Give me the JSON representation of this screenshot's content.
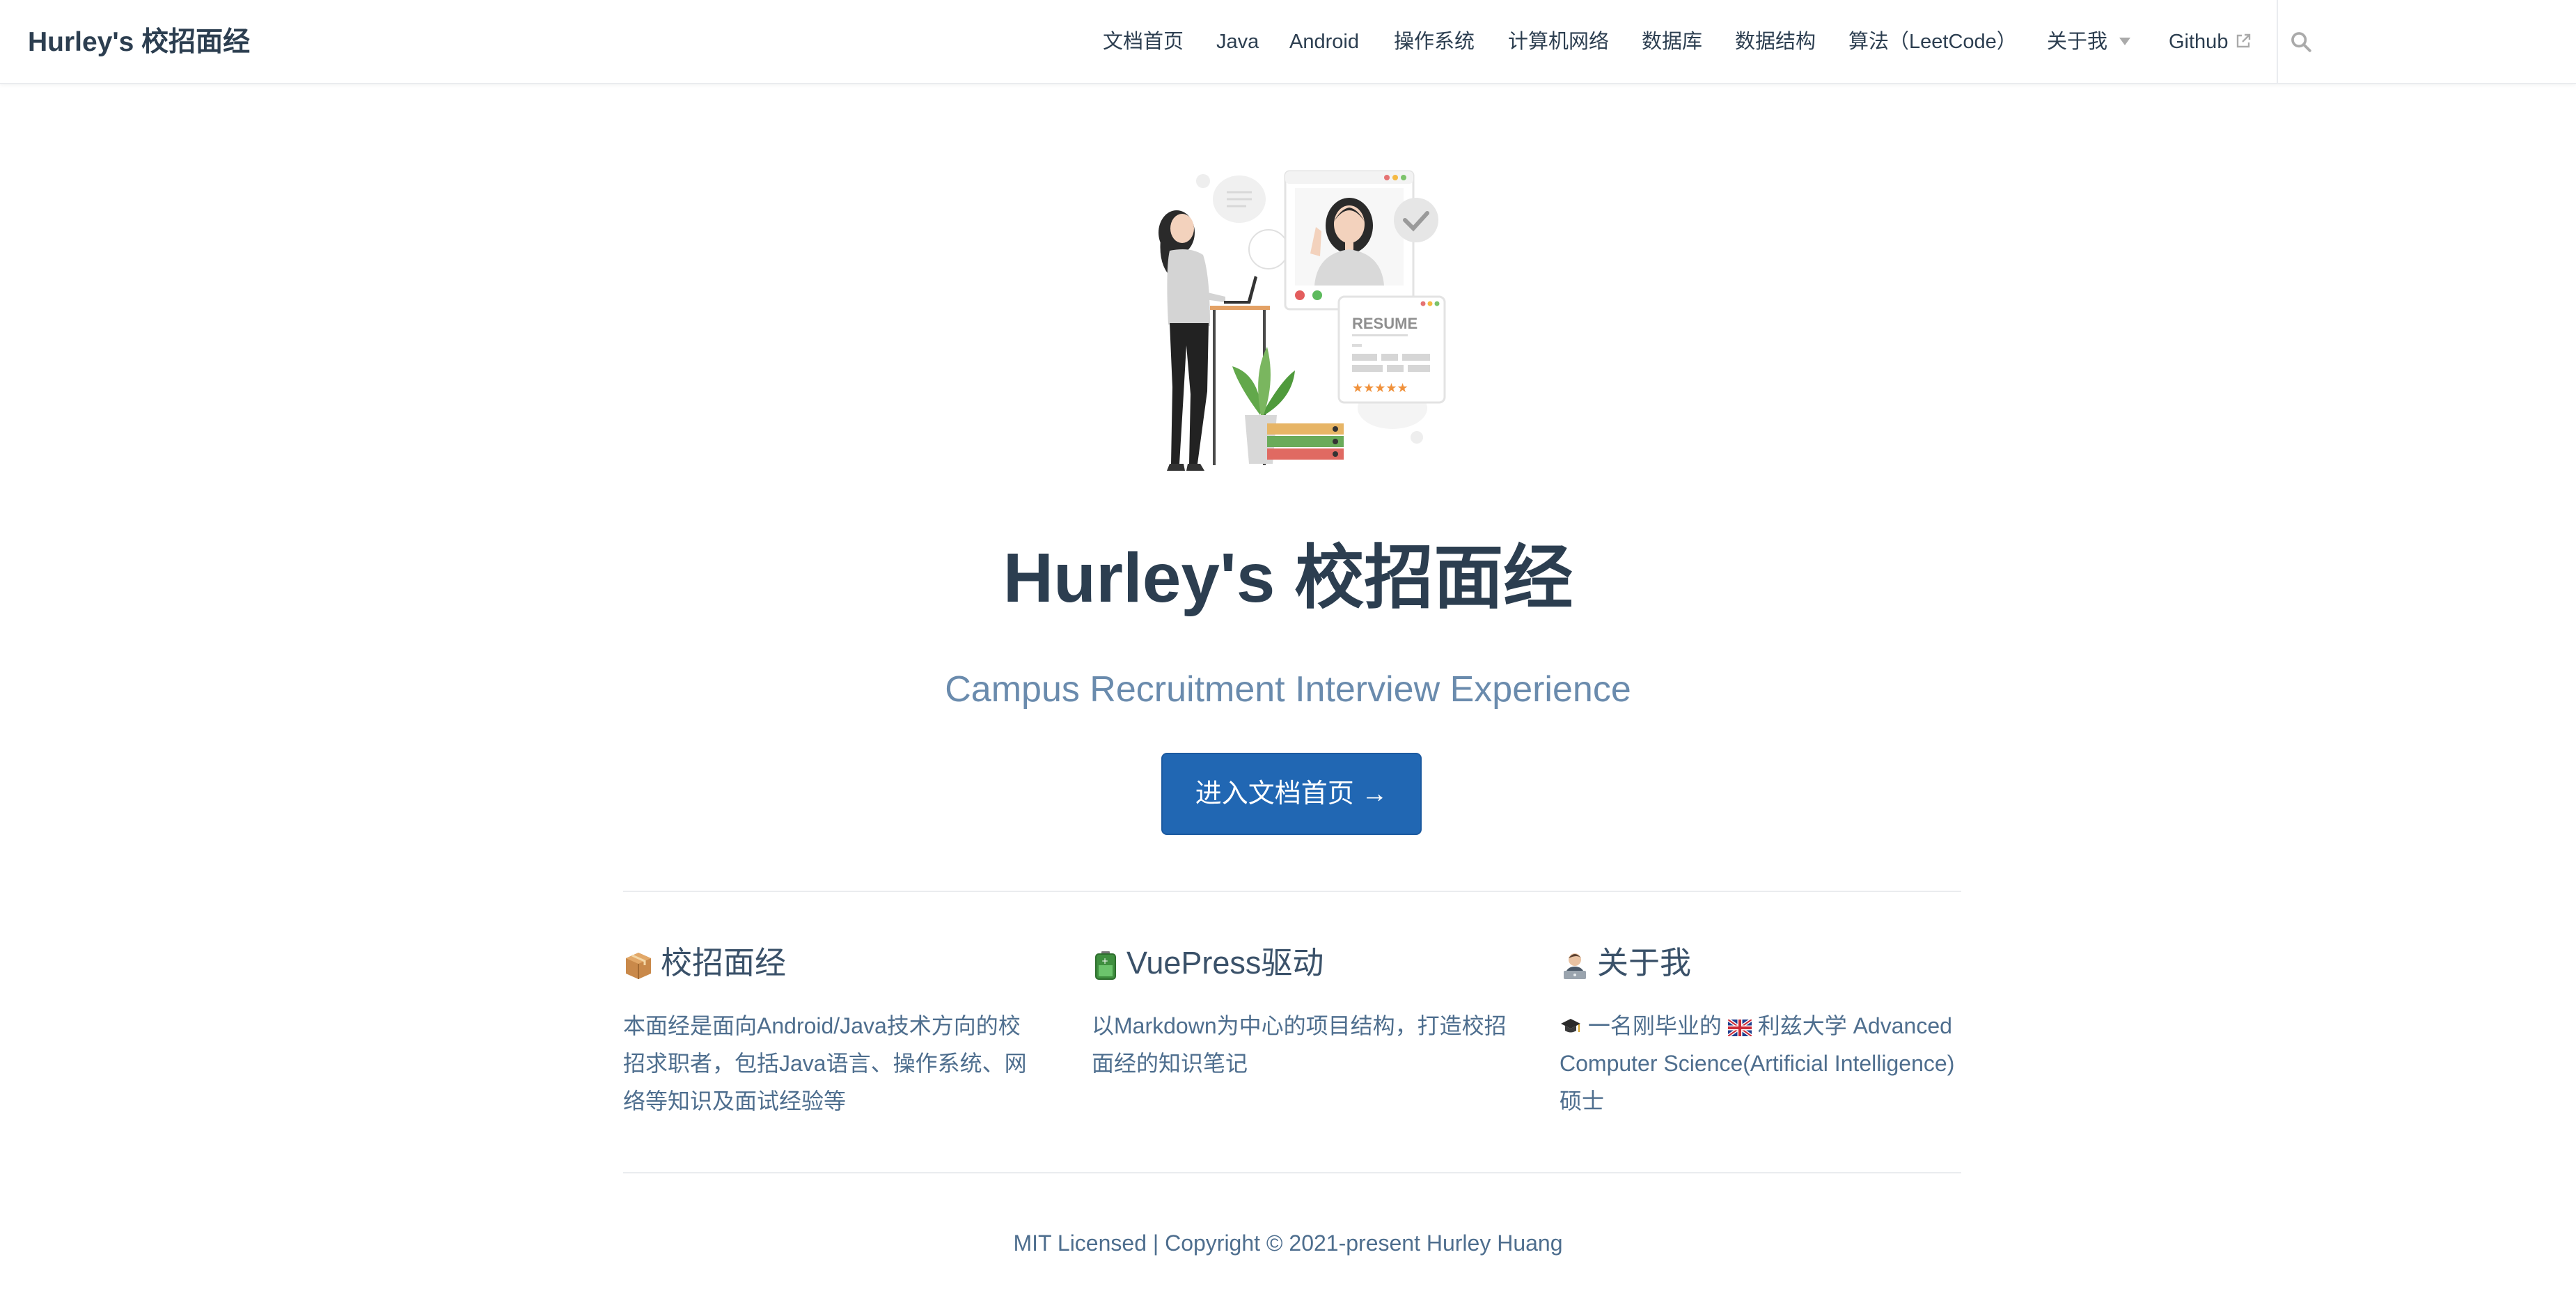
{
  "site": {
    "name": "Hurley's 校招面经"
  },
  "nav": {
    "items": [
      {
        "label": "文档首页"
      },
      {
        "label": "Java"
      },
      {
        "label": "Android"
      },
      {
        "label": "操作系统"
      },
      {
        "label": "计算机网络"
      },
      {
        "label": "数据库"
      },
      {
        "label": "数据结构"
      },
      {
        "label": "算法（LeetCode）"
      },
      {
        "label": "关于我"
      },
      {
        "label": "Github"
      }
    ],
    "dropdown_icon": "caret-down-icon",
    "external_icon": "external-link-icon",
    "search_icon": "search-icon"
  },
  "hero": {
    "image": "interview-illustration",
    "resume_text": "RESUME",
    "title": "Hurley's 校招面经",
    "description": "Campus Recruitment Interview Experience",
    "action": "进入文档首页 →"
  },
  "features": [
    {
      "emoji": "package-icon",
      "title": "校招面经",
      "details": "本面经是面向Android/Java技术方向的校招求职者，包括Java语言、操作系统、网络等知识及面试经验等"
    },
    {
      "emoji": "battery-icon",
      "title": "VuePress驱动",
      "details": "以Markdown为中心的项目结构，打造校招面经的知识笔记"
    },
    {
      "emoji": "technologist-icon",
      "title": "关于我",
      "details_prefix": "一名刚毕业的",
      "details_suffix": "利兹大学 Advanced Computer Science(Artificial Intelligence) 硕士"
    }
  ],
  "footer": {
    "text": "MIT Licensed | Copyright © 2021-present Hurley Huang"
  },
  "colors": {
    "accent": "#2167b3",
    "text": "#2c3e50",
    "muted": "#6a8bad",
    "border": "#eaecef"
  }
}
